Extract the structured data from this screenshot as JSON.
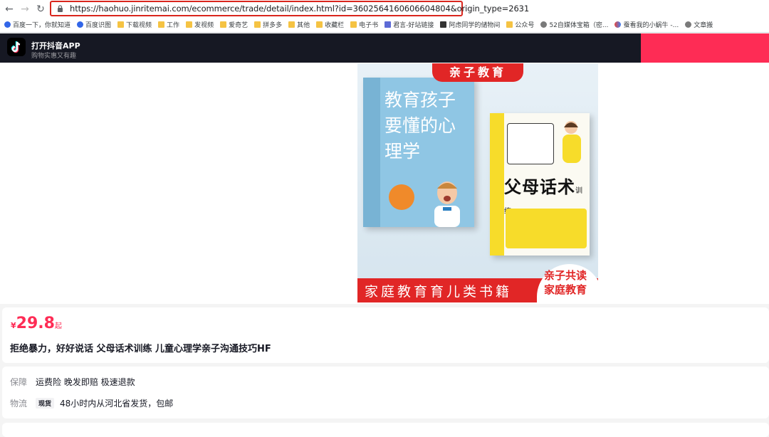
{
  "browser": {
    "url": "https://haohuo.jinritemai.com/ecommerce/trade/detail/index.html?id=3602564160606604804&origin_type=2631",
    "bookmarks": [
      {
        "label": "百度一下，你就知道",
        "icon": "paw"
      },
      {
        "label": "百度识图",
        "icon": "paw"
      },
      {
        "label": "下载视频",
        "icon": "folder"
      },
      {
        "label": "工作",
        "icon": "folder"
      },
      {
        "label": "发视频",
        "icon": "folder"
      },
      {
        "label": "爱奇艺",
        "icon": "folder"
      },
      {
        "label": "拼多多",
        "icon": "folder"
      },
      {
        "label": "其他",
        "icon": "folder"
      },
      {
        "label": "收藏栏",
        "icon": "folder"
      },
      {
        "label": "电子书",
        "icon": "folder"
      },
      {
        "label": "君言-好站链接",
        "icon": "img"
      },
      {
        "label": "阿虑同学的储物间",
        "icon": "dark"
      },
      {
        "label": "公众号",
        "icon": "folder"
      },
      {
        "label": "52自媒体宝箱（密...",
        "icon": "chrome"
      },
      {
        "label": "蚕看我的小蜗牛 -...",
        "icon": "multi"
      },
      {
        "label": "文章搬",
        "icon": "chrome"
      }
    ]
  },
  "app_banner": {
    "title": "打开抖音APP",
    "subtitle": "购物实惠又有趣"
  },
  "hero": {
    "top_tag": "亲子教育",
    "book1_title": "教育孩子要懂的心理学",
    "book2_title": "父母话术",
    "book2_title_suffix": "训练",
    "bottom_text": "家庭教育育儿类书籍",
    "circle_line1": "亲子共读",
    "circle_line2": "家庭教育"
  },
  "product": {
    "currency": "¥",
    "price": "29.8",
    "price_suffix": "起",
    "title": "拒绝暴力，好好说话 父母话术训练 儿童心理学亲子沟通技巧HF"
  },
  "service": {
    "guarantee_label": "保障",
    "guarantee_value": "运费险 晚发即赔 极速退款",
    "logistics_label": "物流",
    "logistics_tag": "现货",
    "logistics_value": "48小时内从河北省发货，包邮"
  },
  "colors": {
    "brand": "#fe2c55",
    "banner_bg": "#161823",
    "hero_red": "#e12626",
    "url_highlight": "#d9251d"
  }
}
